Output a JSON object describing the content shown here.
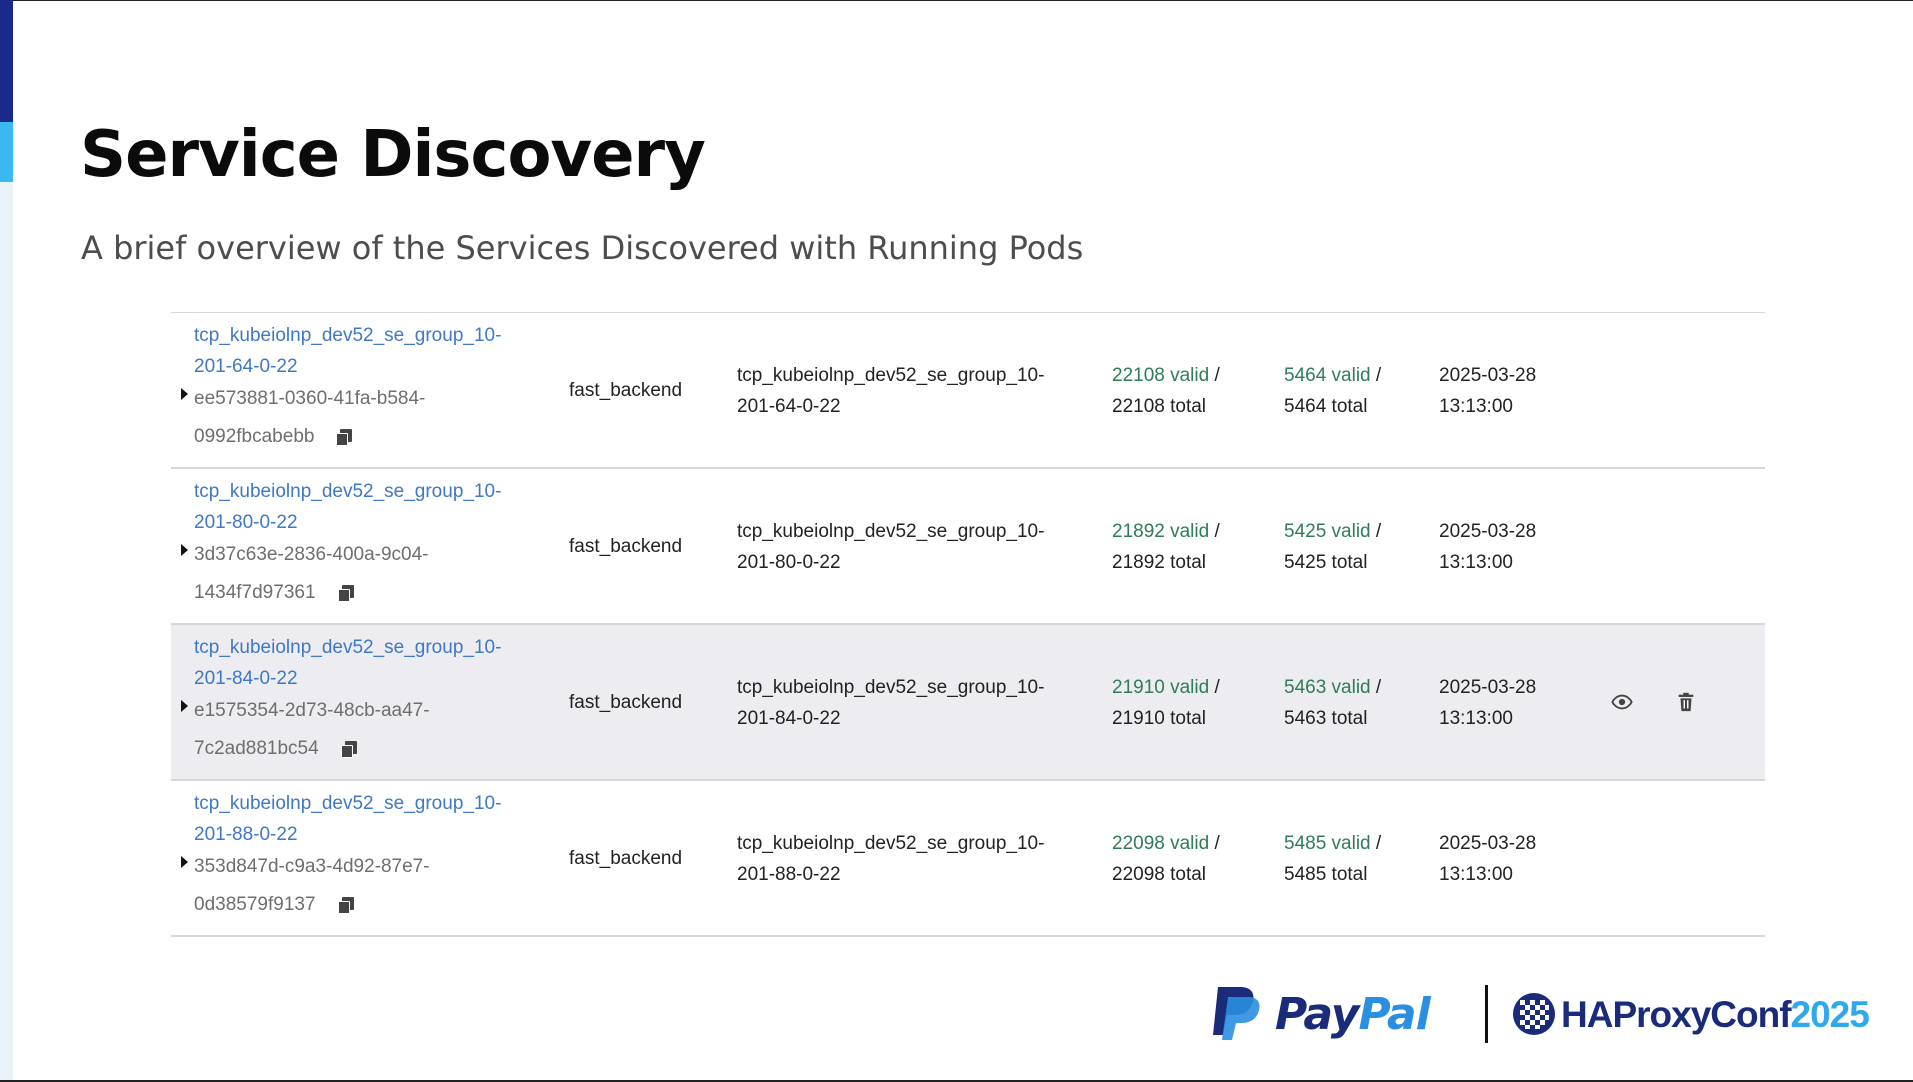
{
  "slide": {
    "title": "Service Discovery",
    "subtitle": "A brief overview of the Services Discovered with Running Pods"
  },
  "table": {
    "rows": [
      {
        "service_link": "tcp_kubeiolnp_dev52_se_group_10-201-64-0-22",
        "service_id": "ee573881-0360-41fa-b584-0992fbcabebb",
        "backend": "fast_backend",
        "server": "tcp_kubeiolnp_dev52_se_group_10-201-64-0-22",
        "health_valid": "22108 valid",
        "health_total": "22108 total",
        "check_valid": "5464 valid",
        "check_total": "5464 total",
        "date": "2025-03-28",
        "time": "13:13:00"
      },
      {
        "service_link": "tcp_kubeiolnp_dev52_se_group_10-201-80-0-22",
        "service_id": "3d37c63e-2836-400a-9c04-1434f7d97361",
        "backend": "fast_backend",
        "server": "tcp_kubeiolnp_dev52_se_group_10-201-80-0-22",
        "health_valid": "21892 valid",
        "health_total": "21892 total",
        "check_valid": "5425 valid",
        "check_total": "5425 total",
        "date": "2025-03-28",
        "time": "13:13:00"
      },
      {
        "service_link": "tcp_kubeiolnp_dev52_se_group_10-201-84-0-22",
        "service_id": "e1575354-2d73-48cb-aa47-7c2ad881bc54",
        "backend": "fast_backend",
        "server": "tcp_kubeiolnp_dev52_se_group_10-201-84-0-22",
        "health_valid": "21910 valid",
        "health_total": "21910 total",
        "check_valid": "5463 valid",
        "check_total": "5463 total",
        "date": "2025-03-28",
        "time": "13:13:00"
      },
      {
        "service_link": "tcp_kubeiolnp_dev52_se_group_10-201-88-0-22",
        "service_id": "353d847d-c9a3-4d92-87e7-0d38579f9137",
        "backend": "fast_backend",
        "server": "tcp_kubeiolnp_dev52_se_group_10-201-88-0-22",
        "health_valid": "22098 valid",
        "health_total": "22098 total",
        "check_valid": "5485 valid",
        "check_total": "5485 total",
        "date": "2025-03-28",
        "time": "13:13:00"
      }
    ],
    "separator": "/",
    "hovered_row": 2,
    "row_action_icons": [
      "eye-icon",
      "trash-icon"
    ]
  },
  "logos": {
    "paypal_pay": "Pay",
    "paypal_pal": "Pal",
    "haproxy_name": "HAProxyConf",
    "haproxy_year": "2025"
  },
  "colors": {
    "link": "#3f78c4",
    "valid": "#2e7d56",
    "accent_dark": "#1a2a8a",
    "accent_light": "#3bb8f0",
    "hover_row": "#ececf1"
  }
}
